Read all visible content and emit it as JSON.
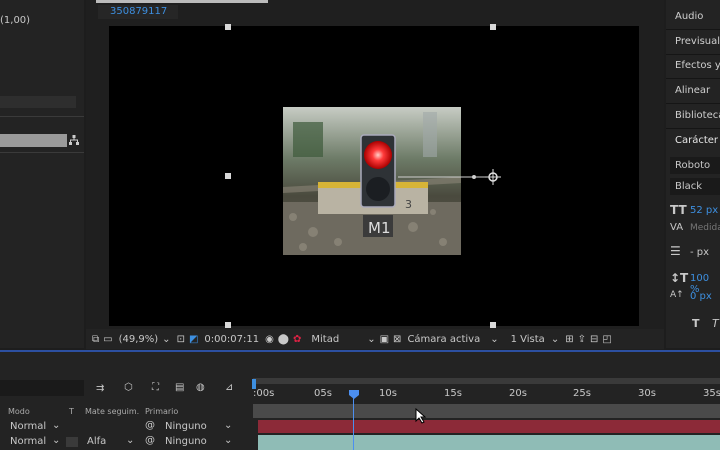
{
  "left_panel": {
    "coord_text": "(1,00)"
  },
  "viewer": {
    "comp_id": "350879117",
    "zoom": "(49,9%)",
    "timecode": "0:00:07:11",
    "resolution": "Mitad",
    "camera": "Cámara activa",
    "views": "1 Vista"
  },
  "right_panel": {
    "items": [
      "Audio",
      "Previsualizar",
      "Efectos y ajustes",
      "Alinear",
      "Bibliotecas",
      "Carácter"
    ],
    "font_name": "Roboto",
    "font_style": "Black",
    "font_size": "52 px",
    "leading": "Medida",
    "tracking": "- px",
    "vscale": "100 %",
    "baseline": "0 px"
  },
  "timeline": {
    "col_mode": "Modo",
    "col_t": "T",
    "col_matte": "Mate seguim.",
    "col_parent": "Primario",
    "rows": [
      {
        "mode": "Normal",
        "matte": "",
        "parent": "Ninguno"
      },
      {
        "mode": "Normal",
        "matte": "Alfa",
        "parent": "Ninguno"
      }
    ],
    "ruler": [
      ":00s",
      "05s",
      "10s",
      "15s",
      "20s",
      "25s",
      "30s",
      "35s"
    ]
  },
  "colors": {
    "accent": "#3d8fe0",
    "layer_red": "#8c2a38",
    "layer_teal": "#8fbcb6"
  }
}
